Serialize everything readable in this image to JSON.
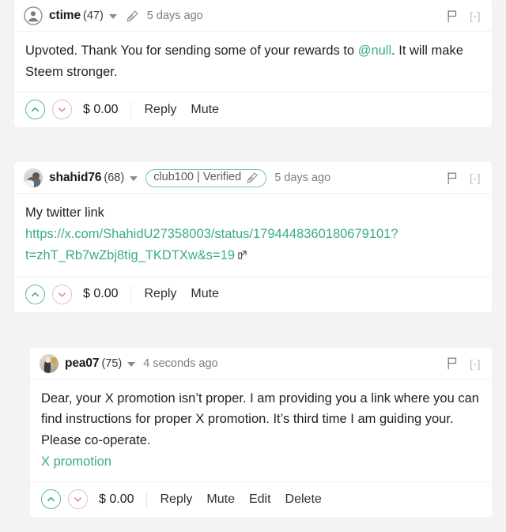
{
  "theme": {
    "page_background": "#f3f3f3",
    "card_background": "#ffffff",
    "link_color": "#3aab8f",
    "upvote_color": "#57bb9c",
    "downvote_color": "#e8bcc0",
    "badge_border_color": "#6ec6ad",
    "text_color": "#201f1f",
    "muted_text_color": "#7d7d7d"
  },
  "comments": [
    {
      "id": "comment-ctime",
      "author": "ctime",
      "reputation": "(47)",
      "avatar_icon": "user-avatar-icon",
      "edited_icon": "pencil-icon",
      "timestamp": "5 days ago",
      "flag_icon": "flag-icon",
      "collapse_label": "[-]",
      "badge": null,
      "body": {
        "text_before": "Upvoted. Thank You for sending some of your rewards to ",
        "mention": "@null",
        "text_after": ". It will make Steem stronger."
      },
      "upvote_icon": "chevron-up-icon",
      "downvote_icon": "chevron-down-icon",
      "payout": "$ 0.00",
      "actions": [
        "Reply",
        "Mute"
      ]
    },
    {
      "id": "comment-shahid76",
      "author": "shahid76",
      "reputation": "(68)",
      "avatar_icon": "user-photo-avatar",
      "timestamp": "5 days ago",
      "flag_icon": "flag-icon",
      "collapse_label": "[-]",
      "badge": {
        "label": "club100 | Verified",
        "icon": "pencil-icon"
      },
      "body": {
        "line1": "My twitter link",
        "link_text": "https://x.com/ShahidU27358003/status/1794448360180679101?t=zhT_Rb7wZbj8tig_TKDTXw&s=19",
        "link_icon": "external-link-icon"
      },
      "upvote_icon": "chevron-up-icon",
      "downvote_icon": "chevron-down-icon",
      "payout": "$ 0.00",
      "actions": [
        "Reply",
        "Mute"
      ]
    },
    {
      "id": "comment-pea07",
      "author": "pea07",
      "reputation": "(75)",
      "avatar_icon": "user-photo-avatar",
      "timestamp": "4 seconds ago",
      "flag_icon": "flag-icon",
      "collapse_label": "[-]",
      "badge": null,
      "nested": true,
      "body": {
        "paragraph": "Dear, your X promotion isn’t proper. I am providing you a link where you can find instructions for proper X promotion. It’s third time I am guiding your. Please co-operate.",
        "link_text": "X promotion"
      },
      "upvote_icon": "chevron-up-icon",
      "downvote_icon": "chevron-down-icon",
      "payout": "$ 0.00",
      "actions": [
        "Reply",
        "Mute",
        "Edit",
        "Delete"
      ]
    }
  ]
}
